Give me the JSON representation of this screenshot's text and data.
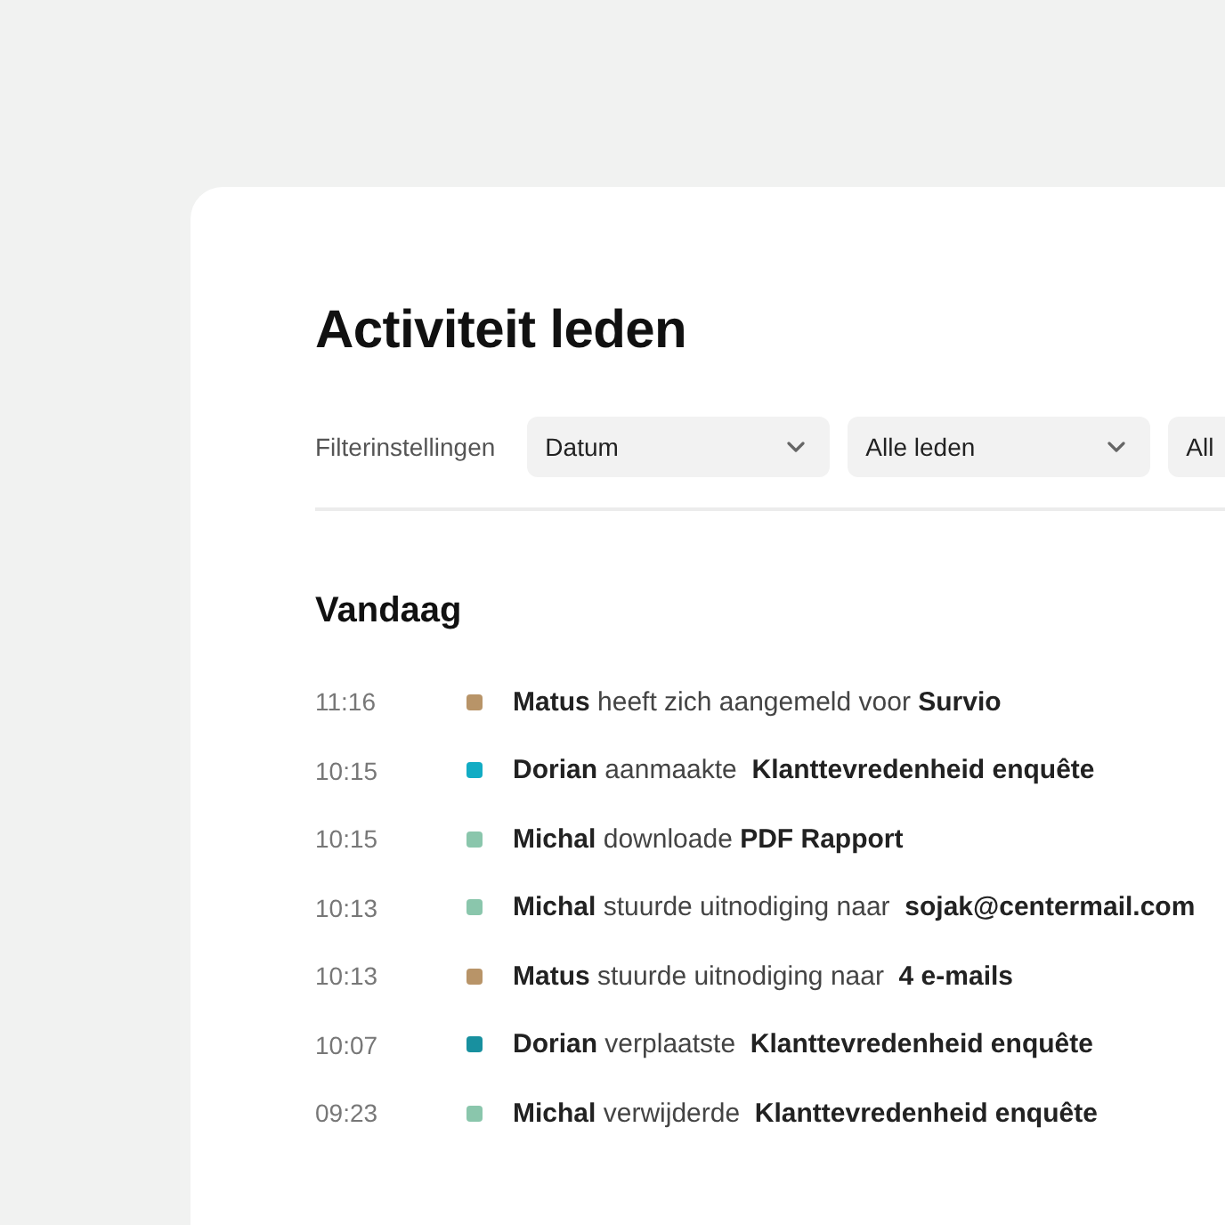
{
  "title": "Activiteit leden",
  "filters": {
    "label": "Filterinstellingen",
    "dropdowns": [
      {
        "value": "Datum"
      },
      {
        "value": "Alle leden"
      },
      {
        "value": "All"
      }
    ]
  },
  "section": "Vandaag",
  "activities": [
    {
      "time": "11:16",
      "color": "#b89468",
      "text": "**Matus** heeft zich aangemeld voor **Survio**"
    },
    {
      "time": "10:15",
      "color": "#12acc4",
      "text": "**Dorian** aanmaakte  **Klanttevredenheid enquête**"
    },
    {
      "time": "10:15",
      "color": "#8ac6ac",
      "text": "**Michal** downloade **PDF Rapport**"
    },
    {
      "time": "10:13",
      "color": "#8ac6ac",
      "text": "**Michal** stuurde uitnodiging naar  **sojak@centermail.com**"
    },
    {
      "time": "10:13",
      "color": "#b89468",
      "text": "**Matus** stuurde uitnodiging naar  **4 e-mails**"
    },
    {
      "time": "10:07",
      "color": "#18909f",
      "text": "**Dorian** verplaatste  **Klanttevredenheid enquête**"
    },
    {
      "time": "09:23",
      "color": "#8ac6ac",
      "text": "**Michal** verwijderde  **Klanttevredenheid enquête**"
    }
  ]
}
